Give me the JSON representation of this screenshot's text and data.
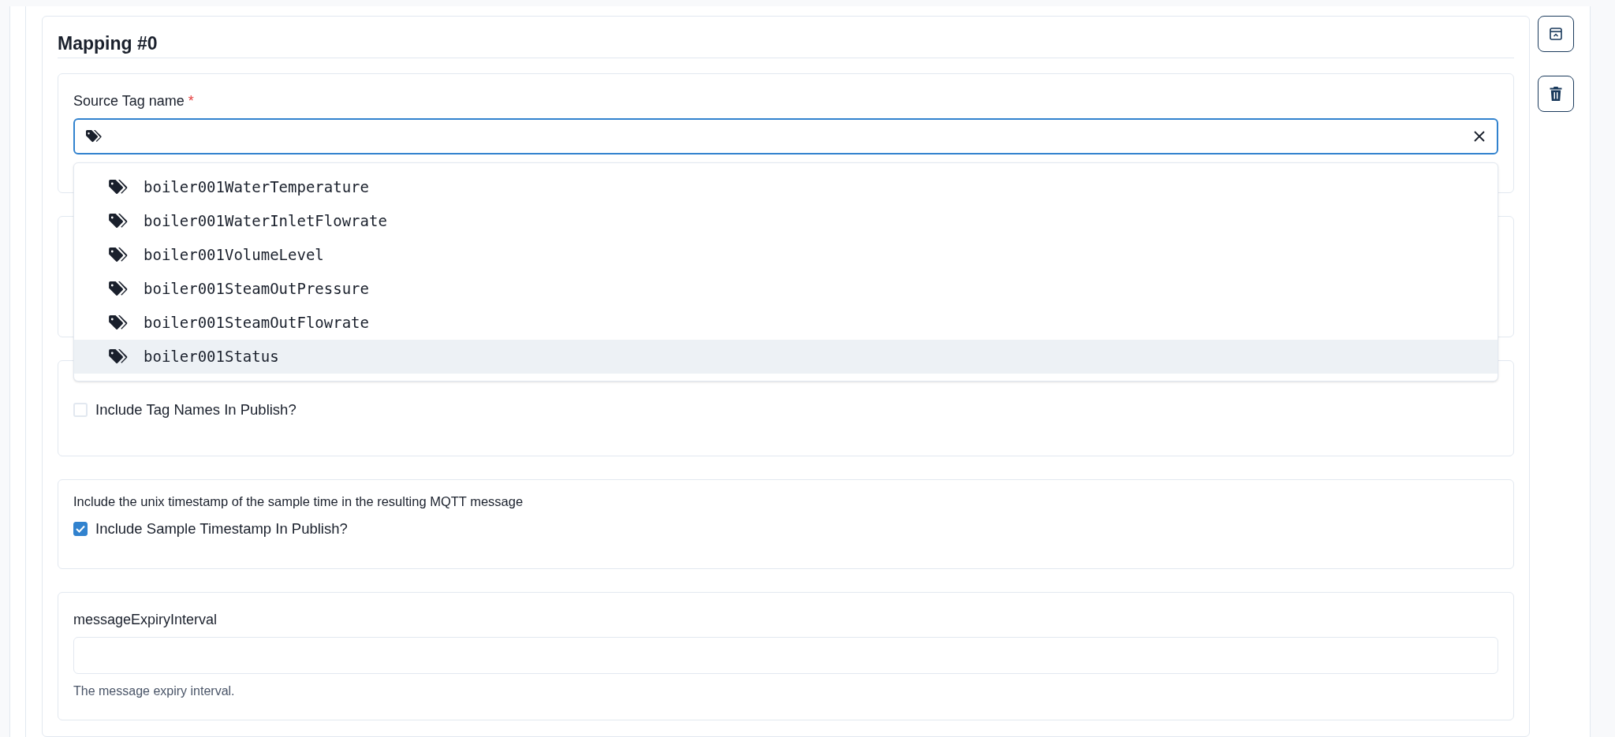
{
  "mapping": {
    "title": "Mapping #0"
  },
  "source_tag": {
    "label": "Source Tag name",
    "required_mark": "*",
    "focused": true,
    "options": [
      {
        "label": "boiler001WaterTemperature",
        "selected": false
      },
      {
        "label": "boiler001WaterInletFlowrate",
        "selected": false
      },
      {
        "label": "boiler001VolumeLevel",
        "selected": false
      },
      {
        "label": "boiler001SteamOutPressure",
        "selected": false
      },
      {
        "label": "boiler001SteamOutFlowrate",
        "selected": false
      },
      {
        "label": "boiler001Status",
        "selected": true
      }
    ]
  },
  "tag_names_option": {
    "label": "Include Tag Names In Publish?",
    "checked": false
  },
  "timestamp_option": {
    "description": "Include the unix timestamp of the sample time in the resulting MQTT message",
    "label": "Include Sample Timestamp In Publish?",
    "checked": true
  },
  "expiry": {
    "label": "messageExpiryInterval",
    "help": "The message expiry interval."
  }
}
